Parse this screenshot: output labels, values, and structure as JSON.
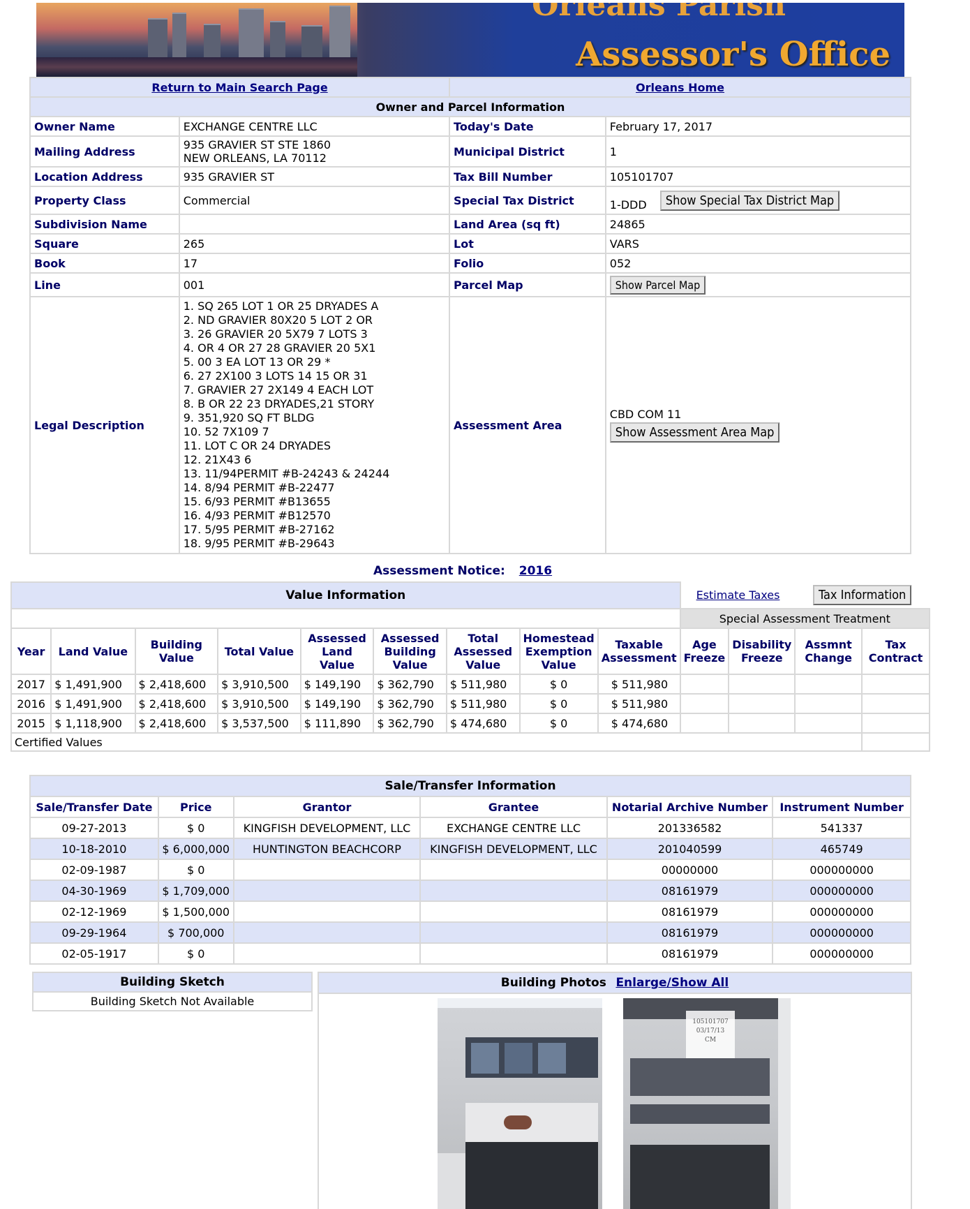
{
  "banner": {
    "line1": "Orleans Parish",
    "line2": "Assessor's Office"
  },
  "nav": {
    "main_search": "Return to Main Search Page",
    "home": "Orleans Home"
  },
  "owner_section": {
    "title": "Owner and Parcel Information",
    "labels": {
      "owner_name": "Owner Name",
      "todays_date": "Today's Date",
      "mailing_address": "Mailing Address",
      "municipal_district": "Municipal District",
      "location_address": "Location Address",
      "tax_bill_number": "Tax Bill Number",
      "property_class": "Property Class",
      "special_tax_district": "Special Tax District",
      "subdivision_name": "Subdivision Name",
      "land_area": "Land Area (sq ft)",
      "square": "Square",
      "lot": "Lot",
      "book": "Book",
      "folio": "Folio",
      "line": "Line",
      "parcel_map": "Parcel Map",
      "legal_description": "Legal Description",
      "assessment_area": "Assessment Area"
    },
    "values": {
      "owner_name": "EXCHANGE CENTRE LLC",
      "todays_date": "February 17, 2017",
      "mailing_line1": "935 GRAVIER ST STE 1860",
      "mailing_line2": "NEW ORLEANS, LA 70112",
      "municipal_district": "1",
      "location_address": "935 GRAVIER ST",
      "tax_bill_number": "105101707",
      "property_class": "Commercial",
      "special_tax_district": "1-DDD",
      "subdivision_name": "",
      "land_area": "24865",
      "square": "265",
      "lot": "VARS",
      "book": "17",
      "folio": "052",
      "line": "001",
      "assessment_area": "CBD COM 11"
    },
    "buttons": {
      "special_tax_map": "Show Special Tax District Map",
      "parcel_map": "Show Parcel Map",
      "assessment_area_map": "Show Assessment Area Map"
    },
    "legal_description": [
      "1. SQ 265 LOT 1 OR 25 DRYADES A",
      "2. ND GRAVIER 80X20 5 LOT 2 OR",
      "3. 26 GRAVIER 20 5X79 7 LOTS 3",
      "4. OR 4 OR 27 28 GRAVIER 20 5X1",
      "5. 00 3 EA LOT 13 OR 29 *",
      "6. 27 2X100 3 LOTS 14 15 OR 31",
      "7. GRAVIER 27 2X149 4 EACH LOT",
      "8. B OR 22 23 DRYADES,21 STORY",
      "9. 351,920 SQ FT BLDG",
      "10. 52 7X109 7",
      "11. LOT C OR 24 DRYADES",
      "12. 21X43 6",
      "13. 11/94PERMIT #B-24243 & 24244",
      "14. 8/94 PERMIT #B-22477",
      "15. 6/93 PERMIT #B13655",
      "16. 4/93 PERMIT #B12570",
      "17. 5/95 PERMIT #B-27162",
      "18. 9/95 PERMIT #B-29643"
    ]
  },
  "assessment_notice": {
    "label": "Assessment Notice:",
    "year": "2016"
  },
  "value_section": {
    "title": "Value Information",
    "estimate_taxes": "Estimate Taxes",
    "tax_information": "Tax Information",
    "special_treatment": "Special Assessment Treatment",
    "headers": {
      "year": "Year",
      "land_value": "Land Value",
      "building_value_1": "Building",
      "building_value_2": "Value",
      "total_value": "Total Value",
      "assessed_land_1": "Assessed",
      "assessed_land_2": "Land Value",
      "assessed_bldg_1": "Assessed",
      "assessed_bldg_2": "Building",
      "assessed_bldg_3": "Value",
      "total_assessed_1": "Total",
      "total_assessed_2": "Assessed",
      "total_assessed_3": "Value",
      "homestead_1": "Homestead",
      "homestead_2": "Exemption",
      "homestead_3": "Value",
      "taxable_1": "Taxable",
      "taxable_2": "Assessment",
      "age_1": "Age",
      "age_2": "Freeze",
      "disability_1": "Disability",
      "disability_2": "Freeze",
      "assmnt_1": "Assmnt",
      "assmnt_2": "Change",
      "contract_1": "Tax",
      "contract_2": "Contract"
    },
    "rows": [
      {
        "year": "2017",
        "land": "$ 1,491,900",
        "building": "$ 2,418,600",
        "total": "$ 3,910,500",
        "a_land": "$ 149,190",
        "a_bldg": "$ 362,790",
        "t_assessed": "$ 511,980",
        "homestead": "$ 0",
        "taxable": "$ 511,980"
      },
      {
        "year": "2016",
        "land": "$ 1,491,900",
        "building": "$ 2,418,600",
        "total": "$ 3,910,500",
        "a_land": "$ 149,190",
        "a_bldg": "$ 362,790",
        "t_assessed": "$ 511,980",
        "homestead": "$ 0",
        "taxable": "$ 511,980"
      },
      {
        "year": "2015",
        "land": "$ 1,118,900",
        "building": "$ 2,418,600",
        "total": "$ 3,537,500",
        "a_land": "$ 111,890",
        "a_bldg": "$ 362,790",
        "t_assessed": "$ 474,680",
        "homestead": "$ 0",
        "taxable": "$ 474,680"
      }
    ],
    "certified": "Certified Values"
  },
  "sale_section": {
    "title": "Sale/Transfer Information",
    "headers": {
      "date": "Sale/Transfer Date",
      "price": "Price",
      "grantor": "Grantor",
      "grantee": "Grantee",
      "notarial": "Notarial Archive Number",
      "instrument": "Instrument Number"
    },
    "rows": [
      {
        "date": "09-27-2013",
        "price": "$ 0",
        "grantor": "KINGFISH DEVELOPMENT, LLC",
        "grantee": "EXCHANGE CENTRE LLC",
        "notarial": "201336582",
        "instrument": "541337"
      },
      {
        "date": "10-18-2010",
        "price": "$ 6,000,000",
        "grantor": "HUNTINGTON BEACHCORP",
        "grantee": "KINGFISH DEVELOPMENT, LLC",
        "notarial": "201040599",
        "instrument": "465749"
      },
      {
        "date": "02-09-1987",
        "price": "$ 0",
        "grantor": "",
        "grantee": "",
        "notarial": "00000000",
        "instrument": "000000000"
      },
      {
        "date": "04-30-1969",
        "price": "$ 1,709,000",
        "grantor": "",
        "grantee": "",
        "notarial": "08161979",
        "instrument": "000000000"
      },
      {
        "date": "02-12-1969",
        "price": "$ 1,500,000",
        "grantor": "",
        "grantee": "",
        "notarial": "08161979",
        "instrument": "000000000"
      },
      {
        "date": "09-29-1964",
        "price": "$ 700,000",
        "grantor": "",
        "grantee": "",
        "notarial": "08161979",
        "instrument": "000000000"
      },
      {
        "date": "02-05-1917",
        "price": "$ 0",
        "grantor": "",
        "grantee": "",
        "notarial": "08161979",
        "instrument": "000000000"
      }
    ]
  },
  "sketch": {
    "title": "Building Sketch",
    "status": "Building Sketch Not Available"
  },
  "photos": {
    "title": "Building Photos",
    "link": "Enlarge/Show All",
    "stamp_1": "105101707",
    "stamp_2": "03/17/13",
    "stamp_3": "CM"
  }
}
